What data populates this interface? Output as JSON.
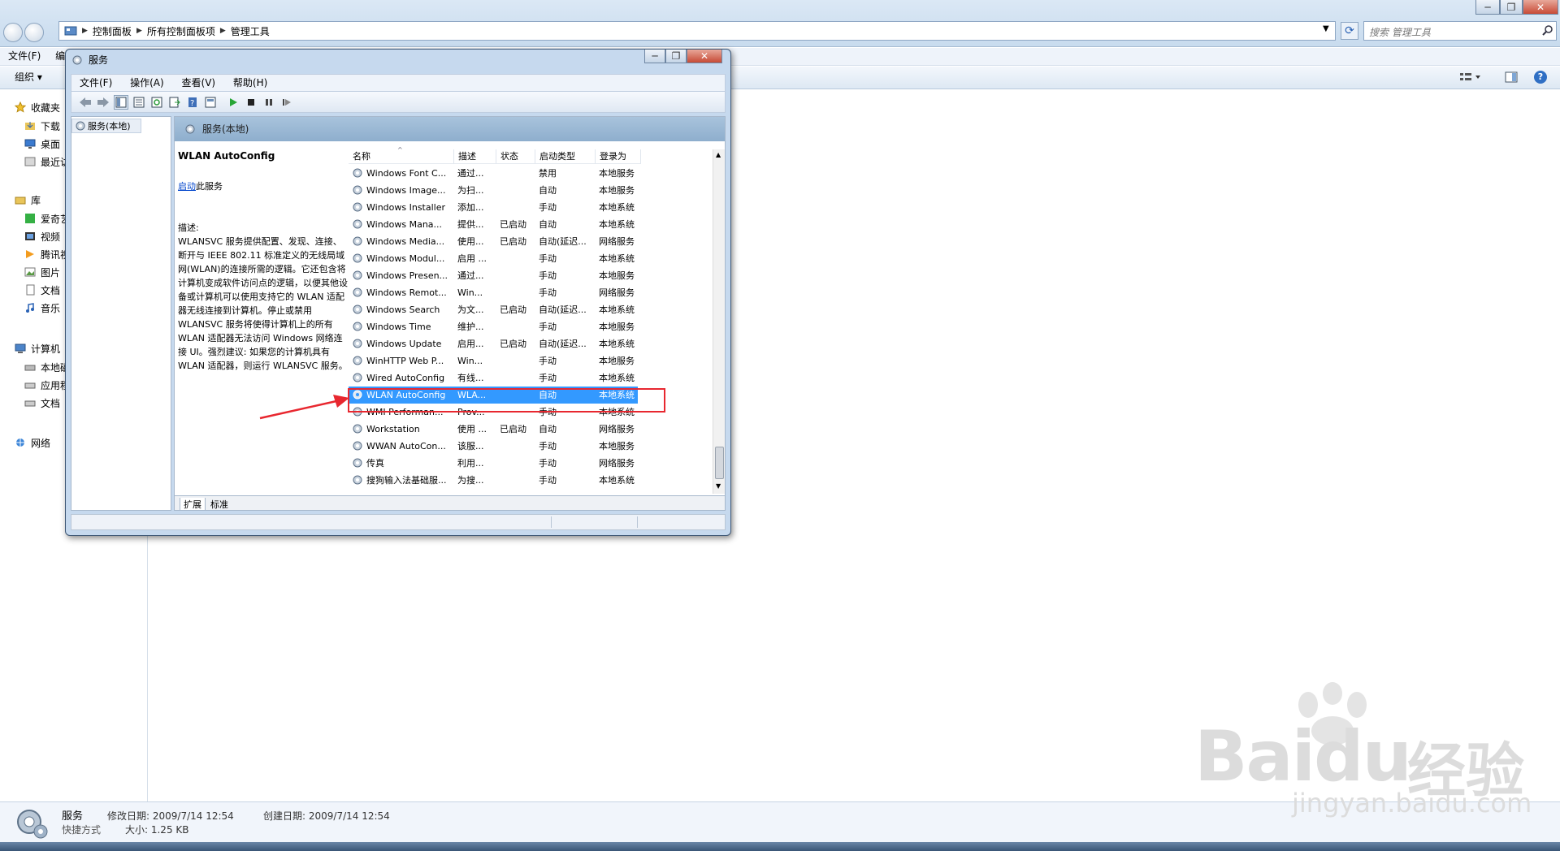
{
  "explorer": {
    "breadcrumb": [
      "控制面板",
      "所有控制面板项",
      "管理工具"
    ],
    "search_placeholder": "搜索 管理工具",
    "menu": [
      "文件(F)",
      "编辑"
    ],
    "organize_label": "组织 ▾",
    "nav": {
      "favorites": "收藏夹",
      "fav_items": [
        "下载",
        "桌面",
        "最近访"
      ],
      "libraries": "库",
      "lib_items": [
        "爱奇艺",
        "视频",
        "腾讯视",
        "图片",
        "文档",
        "音乐"
      ],
      "computer": "计算机",
      "comp_items": [
        "本地磁",
        "应用程",
        "文档"
      ],
      "network": "网络"
    },
    "status": {
      "name": "服务",
      "type": "快捷方式",
      "modified": "修改日期: 2009/7/14 12:54",
      "size": "大小: 1.25 KB",
      "created": "创建日期: 2009/7/14 12:54"
    }
  },
  "services_window": {
    "title": "服务",
    "menu": [
      "文件(F)",
      "操作(A)",
      "查看(V)",
      "帮助(H)"
    ],
    "tree_root": "服务(本地)",
    "header_title": "服务(本地)",
    "detail": {
      "service_name": "WLAN AutoConfig",
      "start_link": "启动",
      "start_suffix": "此服务",
      "desc_label": "描述:",
      "desc_text": "WLANSVC 服务提供配置、发现、连接、断开与 IEEE 802.11 标准定义的无线局域网(WLAN)的连接所需的逻辑。它还包含将计算机变成软件访问点的逻辑，以便其他设备或计算机可以使用支持它的 WLAN 适配器无线连接到计算机。停止或禁用 WLANSVC 服务将使得计算机上的所有 WLAN 适配器无法访问 Windows 网络连接 UI。强烈建议: 如果您的计算机具有 WLAN 适配器，则运行 WLANSVC 服务。"
    },
    "columns": [
      "名称",
      "描述",
      "状态",
      "启动类型",
      "登录为"
    ],
    "rows": [
      [
        "Windows Font C...",
        "通过...",
        "",
        "禁用",
        "本地服务"
      ],
      [
        "Windows Image...",
        "为扫...",
        "",
        "自动",
        "本地服务"
      ],
      [
        "Windows Installer",
        "添加...",
        "",
        "手动",
        "本地系统"
      ],
      [
        "Windows Mana...",
        "提供...",
        "已启动",
        "自动",
        "本地系统"
      ],
      [
        "Windows Media...",
        "使用...",
        "已启动",
        "自动(延迟...",
        "网络服务"
      ],
      [
        "Windows Modul...",
        "启用 ...",
        "",
        "手动",
        "本地系统"
      ],
      [
        "Windows Presen...",
        "通过...",
        "",
        "手动",
        "本地服务"
      ],
      [
        "Windows Remot...",
        "Win...",
        "",
        "手动",
        "网络服务"
      ],
      [
        "Windows Search",
        "为文...",
        "已启动",
        "自动(延迟...",
        "本地系统"
      ],
      [
        "Windows Time",
        "维护...",
        "",
        "手动",
        "本地服务"
      ],
      [
        "Windows Update",
        "启用...",
        "已启动",
        "自动(延迟...",
        "本地系统"
      ],
      [
        "WinHTTP Web P...",
        "Win...",
        "",
        "手动",
        "本地服务"
      ],
      [
        "Wired AutoConfig",
        "有线...",
        "",
        "手动",
        "本地系统"
      ],
      [
        "WLAN AutoConfig",
        "WLA...",
        "",
        "自动",
        "本地系统"
      ],
      [
        "WMI Performan...",
        "Prov...",
        "",
        "手动",
        "本地系统"
      ],
      [
        "Workstation",
        "使用 ...",
        "已启动",
        "自动",
        "网络服务"
      ],
      [
        "WWAN AutoCon...",
        "该服...",
        "",
        "手动",
        "本地服务"
      ],
      [
        "传真",
        "利用...",
        "",
        "手动",
        "网络服务"
      ],
      [
        "搜狗输入法基础服...",
        "为搜...",
        "",
        "手动",
        "本地系统"
      ]
    ],
    "selected_index": 13,
    "tabs": [
      "扩展",
      "标准"
    ]
  },
  "watermark": {
    "brand": "Baidu",
    "cn": "经验",
    "url": "jingyan.baidu.com"
  },
  "colors": {
    "selection": "#3399ff",
    "highlight_box": "#e8272f",
    "arrow": "#e8272f",
    "link": "#0044cc"
  }
}
